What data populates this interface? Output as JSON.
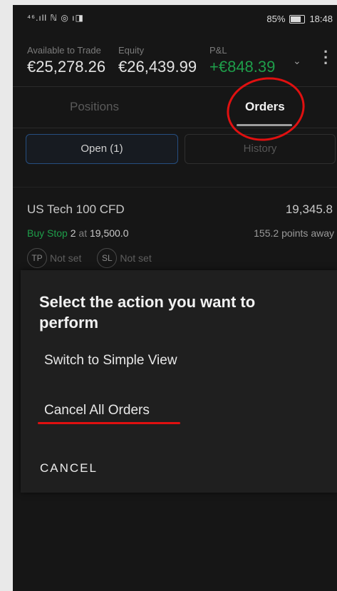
{
  "status_bar": {
    "left": "⁴⁶.ıll ℕ ◎ ı◨",
    "battery_pct": "85%",
    "time": "18:48"
  },
  "header": {
    "available_label": "Available to Trade",
    "available_value": "€25,278.26",
    "equity_label": "Equity",
    "equity_value": "€26,439.99",
    "pnl_label": "P&L",
    "pnl_value": "+€848.39",
    "pnl_color": "#1e9e4a"
  },
  "tabs": [
    {
      "label": "Positions"
    },
    {
      "label": "Orders"
    }
  ],
  "segments": {
    "open": "Open (1)",
    "history": "History"
  },
  "order": {
    "instrument": "US Tech 100 CFD",
    "price": "19,345.8",
    "type": "Buy Stop",
    "qty": "2",
    "at_word": "at",
    "level": "19,500.0",
    "distance": "155.2 points away",
    "tp_label": "TP",
    "tp_value": "Not set",
    "sl_label": "SL",
    "sl_value": "Not set"
  },
  "dialog": {
    "title": "Select the action you want to perform",
    "options": [
      "Switch to Simple View",
      "Cancel All Orders"
    ],
    "cancel_label": "CANCEL",
    "highlight_color": "#e01010"
  },
  "icons": {
    "menu": "chevron-down-icon",
    "more": "kebab-icon"
  }
}
